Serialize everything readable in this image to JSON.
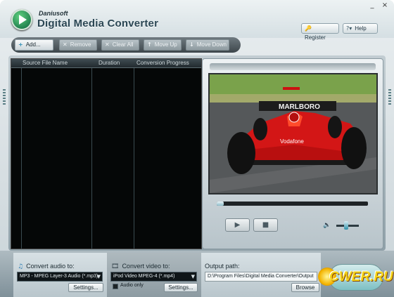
{
  "window": {
    "brand": "Daniusoft",
    "title": "Digital Media Converter",
    "minimize_glyph": "_",
    "close_glyph": "×"
  },
  "header_buttons": {
    "register": "Register",
    "help": "Help"
  },
  "toolbar": {
    "add": "Add...",
    "remove": "Remove",
    "clear_all": "Clear All",
    "move_up": "Move Up",
    "move_down": "Move Down"
  },
  "file_list": {
    "columns": [
      "Source File Name",
      "Duration",
      "Conversion Progress"
    ]
  },
  "player": {
    "play_glyph": "▶",
    "stop_glyph": "■",
    "volume_level": 0.45,
    "progress": 0.0
  },
  "audio_panel": {
    "label": "Convert audio to:",
    "format": "MP3 - MPEG Layer-3 Audio (*.mp3)",
    "settings": "Settings..."
  },
  "video_panel": {
    "label": "Convert video to:",
    "format": "iPod Video MPEG-4 (*.mp4)",
    "audio_only": "Audio only",
    "settings": "Settings..."
  },
  "output_panel": {
    "label": "Output path:",
    "path": "D:\\Program Files\\Digital Media Converter\\Output",
    "browse": "Browse"
  },
  "watermark": "CWER.RU"
}
